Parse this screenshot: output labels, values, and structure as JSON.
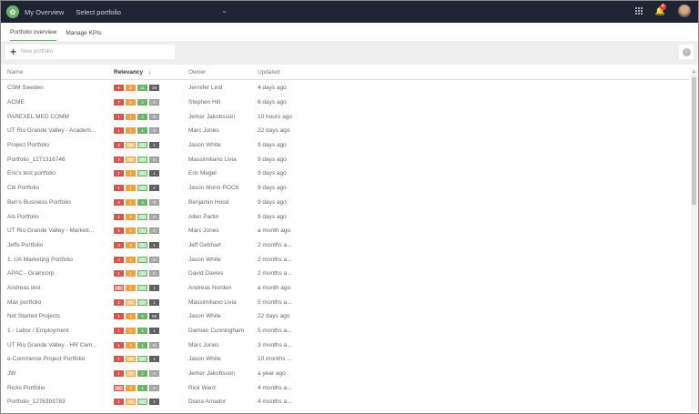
{
  "header": {
    "home": "My Overview",
    "select": "Select portfolio",
    "notifications": "4"
  },
  "tabs": [
    "Portfolio overview",
    "Manage KPIs"
  ],
  "toolbar": {
    "new_portfolio": "New portfolio",
    "info": "i"
  },
  "columns": {
    "name": "Name",
    "relevancy": "Relevancy",
    "sort": "↓",
    "owner": "Owner",
    "updated": "Updated"
  },
  "colors": {
    "red": "#d9534f",
    "orange": "#f0a040",
    "green": "#6cb36c",
    "gray": "#606060",
    "topbar": "#1e2433"
  },
  "rows": [
    {
      "name": "CSM Sweden",
      "b": [
        6,
        2,
        11,
        26
      ],
      "owner": "Jennifer Lind",
      "updated": "4 days ago"
    },
    {
      "name": "ACME",
      "b": [
        7,
        2,
        2,
        0
      ],
      "owner": "Stephen Hill",
      "updated": "6 days ago"
    },
    {
      "name": "PAREXEL MED COMM",
      "b": [
        1,
        1,
        2,
        0
      ],
      "owner": "Jerker Jakobsson",
      "updated": "10 hours ago"
    },
    {
      "name": "UT Rio Grande Valley - Academ...",
      "b": [
        1,
        1,
        1,
        0
      ],
      "owner": "Marc Jones",
      "updated": "22 days ago"
    },
    {
      "name": "Project Portfolio",
      "b": [
        3,
        0,
        0,
        1
      ],
      "owner": "Jason White",
      "updated": "9 days ago"
    },
    {
      "name": "Portfolio_1271316746",
      "b": [
        3,
        0,
        0,
        0
      ],
      "owner": "Massimiliano Livia",
      "updated": "9 days ago"
    },
    {
      "name": "Eric's test portfolio",
      "b": [
        1,
        1,
        0,
        1
      ],
      "owner": "Eric Megel",
      "updated": "9 days ago"
    },
    {
      "name": "Citi Portfolio",
      "b": [
        1,
        1,
        0,
        2
      ],
      "owner": "Jason Morio-POC6",
      "updated": "9 days ago"
    },
    {
      "name": "Ben's Business Portfolio",
      "b": [
        3,
        1,
        4,
        0
      ],
      "owner": "Benjamin Hood",
      "updated": "9 days ago"
    },
    {
      "name": "Als Portfolio",
      "b": [
        2,
        3,
        0,
        0
      ],
      "owner": "Allen Partin",
      "updated": "9 days ago"
    },
    {
      "name": "UT Rio Grande Valley - Marketi...",
      "b": [
        3,
        2,
        0,
        0
      ],
      "owner": "Marc Jones",
      "updated": "a month ago"
    },
    {
      "name": "Jeffs Portfolio",
      "b": [
        3,
        3,
        0,
        1
      ],
      "owner": "Jeff Gebhart",
      "updated": "2 months a..."
    },
    {
      "name": "1. UA Marketing Portfolio",
      "b": [
        2,
        2,
        0,
        0
      ],
      "owner": "Jason White",
      "updated": "2 months a..."
    },
    {
      "name": "APAC - Graincorp",
      "b": [
        1,
        1,
        0,
        0
      ],
      "owner": "David Davies",
      "updated": "2 months a..."
    },
    {
      "name": "Andreas test",
      "b": [
        0,
        1,
        0,
        1
      ],
      "owner": "Andreas Norden",
      "updated": "a month ago"
    },
    {
      "name": "Max portfolio",
      "b": [
        2,
        0,
        0,
        1
      ],
      "owner": "Massimiliano Livia",
      "updated": "5 months a..."
    },
    {
      "name": "Not Started Projects",
      "b": [
        1,
        1,
        4,
        56
      ],
      "owner": "Jason White",
      "updated": "22 days ago"
    },
    {
      "name": "1 - Labor / Employment",
      "b": [
        1,
        2,
        1,
        1
      ],
      "owner": "Damian Cunningham",
      "updated": "5 months a..."
    },
    {
      "name": "UT Rio Grande Valley - HR Cam...",
      "b": [
        1,
        3,
        1,
        0
      ],
      "owner": "Marc Jones",
      "updated": "3 months a..."
    },
    {
      "name": "e-Commerce Project Portfolio",
      "b": [
        1,
        0,
        0,
        1
      ],
      "owner": "Jason White",
      "updated": "10 months ..."
    },
    {
      "name": "JW",
      "b": [
        1,
        0,
        2,
        0
      ],
      "owner": "Jerker Jakobsson",
      "updated": "a year ago"
    },
    {
      "name": "Ricks Portfolio",
      "b": [
        0,
        3,
        1,
        0
      ],
      "owner": "Rick Ward",
      "updated": "4 months a..."
    },
    {
      "name": "Portfolio_1276393783",
      "b": [
        1,
        0,
        0,
        2
      ],
      "owner": "Diana Amador",
      "updated": "4 months a..."
    }
  ]
}
